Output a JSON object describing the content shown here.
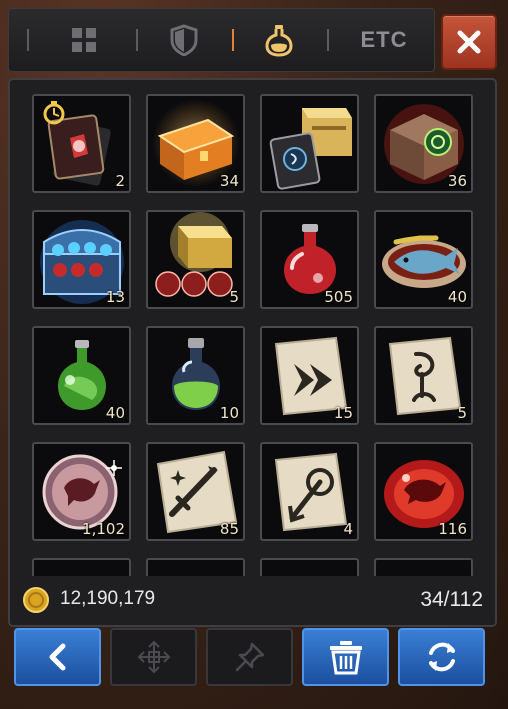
{
  "tabs": [
    {
      "name": "all",
      "icon": "grid-icon"
    },
    {
      "name": "equipment",
      "icon": "shield-icon"
    },
    {
      "name": "consumables",
      "icon": "potion-icon",
      "active": true
    },
    {
      "name": "etc",
      "label": "ETC"
    }
  ],
  "inventory": {
    "items": [
      {
        "icon": "timed-card-pack-icon",
        "qty": "2"
      },
      {
        "icon": "orange-chest-icon",
        "qty": "34"
      },
      {
        "icon": "card-and-gold-chest-icon",
        "qty": ""
      },
      {
        "icon": "green-seal-chest-icon",
        "qty": "36"
      },
      {
        "icon": "blue-chest-with-orbs-icon",
        "qty": "13"
      },
      {
        "icon": "gold-chest-with-red-orbs-icon",
        "qty": "5"
      },
      {
        "icon": "red-potion-icon",
        "qty": "505"
      },
      {
        "icon": "fish-dish-icon",
        "qty": "40"
      },
      {
        "icon": "green-potion-icon",
        "qty": "40"
      },
      {
        "icon": "green-elixir-icon",
        "qty": "10"
      },
      {
        "icon": "dash-scroll-icon",
        "qty": "15"
      },
      {
        "icon": "rune-scroll-icon",
        "qty": "5"
      },
      {
        "icon": "dragon-orb-icon",
        "qty": "1,102"
      },
      {
        "icon": "sword-scroll-icon",
        "qty": "85"
      },
      {
        "icon": "arrow-scroll-icon",
        "qty": "4"
      },
      {
        "icon": "red-dragon-gem-icon",
        "qty": "116"
      }
    ],
    "gold": "12,190,179",
    "capacity": "34/112"
  },
  "colors": {
    "accent": "#e0823c",
    "blue_button": "#2d6ac0",
    "close_button": "#b4432c"
  },
  "bottom_buttons": [
    {
      "icon": "back-arrow-icon",
      "active": true
    },
    {
      "icon": "move-cross-icon",
      "active": false
    },
    {
      "icon": "pin-icon",
      "active": false
    },
    {
      "icon": "trash-icon",
      "active": true
    },
    {
      "icon": "refresh-icon",
      "active": true
    }
  ]
}
